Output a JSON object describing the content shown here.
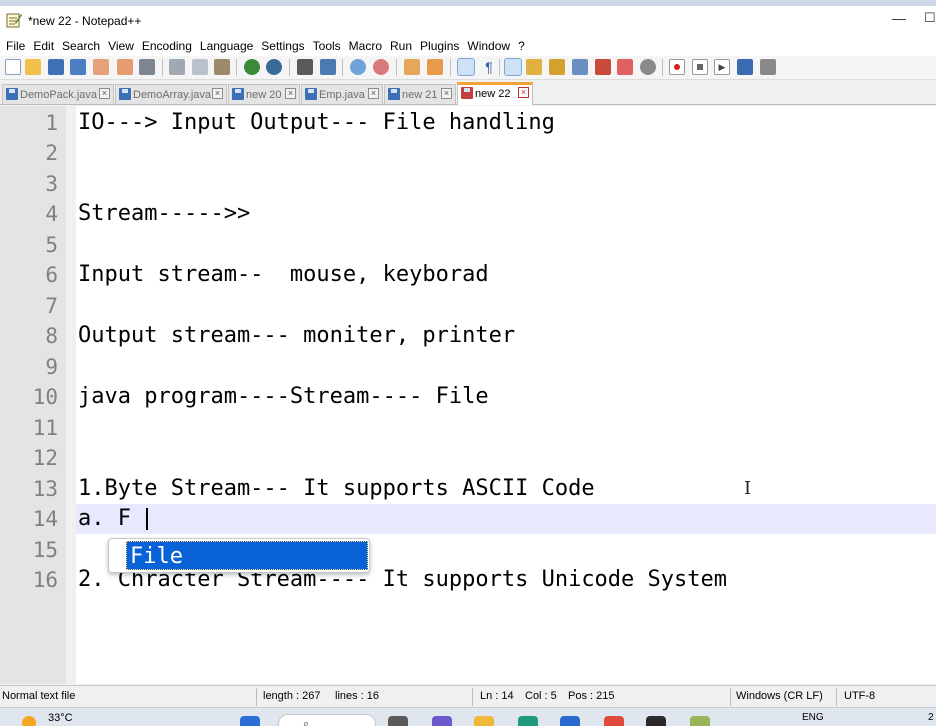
{
  "window": {
    "title": "*new 22 - Notepad++",
    "minimize_glyph": "—",
    "maximize_glyph": "☐"
  },
  "menu": [
    "File",
    "Edit",
    "Search",
    "View",
    "Encoding",
    "Language",
    "Settings",
    "Tools",
    "Macro",
    "Run",
    "Plugins",
    "Window",
    "?"
  ],
  "toolbar": {
    "icons": [
      "new-file",
      "open-file",
      "save",
      "save-all",
      "close",
      "close-all",
      "print",
      "cut",
      "copy",
      "paste",
      "undo",
      "redo",
      "find",
      "replace",
      "zoom-in",
      "zoom-out",
      "sync-vertical",
      "sync-horizontal",
      "word-wrap",
      "show-all-characters",
      "indent-guide",
      "user-defined-language",
      "document-map",
      "function-list",
      "folder-as-workspace",
      "monitoring",
      "record-macro",
      "stop-recording",
      "playback-macro",
      "run-macro-multiple",
      "save-macro"
    ]
  },
  "tabs": [
    {
      "label": "DemoPack.java",
      "close": "×",
      "active": false
    },
    {
      "label": "DemoArray.java",
      "close": "×",
      "active": false
    },
    {
      "label": "new 20",
      "close": "×",
      "active": false
    },
    {
      "label": "Emp.java",
      "close": "×",
      "active": false
    },
    {
      "label": "new 21",
      "close": "×",
      "active": false
    },
    {
      "label": "new 22",
      "close": "×",
      "active": true
    }
  ],
  "editor": {
    "lines": [
      {
        "num": "1",
        "text": "IO---> Input Output--- File handling"
      },
      {
        "num": "2",
        "text": ""
      },
      {
        "num": "3",
        "text": ""
      },
      {
        "num": "4",
        "text": "Stream----->>"
      },
      {
        "num": "5",
        "text": ""
      },
      {
        "num": "6",
        "text": "Input stream--  mouse, keyborad"
      },
      {
        "num": "7",
        "text": ""
      },
      {
        "num": "8",
        "text": "Output stream--- moniter, printer"
      },
      {
        "num": "9",
        "text": ""
      },
      {
        "num": "10",
        "text": "java program----Stream---- File"
      },
      {
        "num": "11",
        "text": ""
      },
      {
        "num": "12",
        "text": ""
      },
      {
        "num": "13",
        "text": "1.Byte Stream--- It supports ASCII Code"
      },
      {
        "num": "14",
        "text": "a. F"
      },
      {
        "num": "15",
        "text": ""
      },
      {
        "num": "16",
        "text": "2. Chracter Stream---- It supports Unicode System"
      }
    ],
    "current_line": 14,
    "ibeam_glyph": "I"
  },
  "autocomplete": {
    "items": [
      "File"
    ],
    "selected": "File"
  },
  "status": {
    "type": "Normal text file",
    "length": "length : 267",
    "lines": "lines : 16",
    "ln": "Ln : 14",
    "col": "Col : 5",
    "pos": "Pos : 215",
    "eol": "Windows (CR LF)",
    "encoding": "UTF-8"
  },
  "taskbar": {
    "temperature": "33°C",
    "language": "ENG",
    "clock": "2"
  },
  "colors": {
    "accent_tab": "#f6a23b",
    "selection": "#0a63d6",
    "current_line": "#e8e8ff",
    "line_numbers": "#808080"
  }
}
